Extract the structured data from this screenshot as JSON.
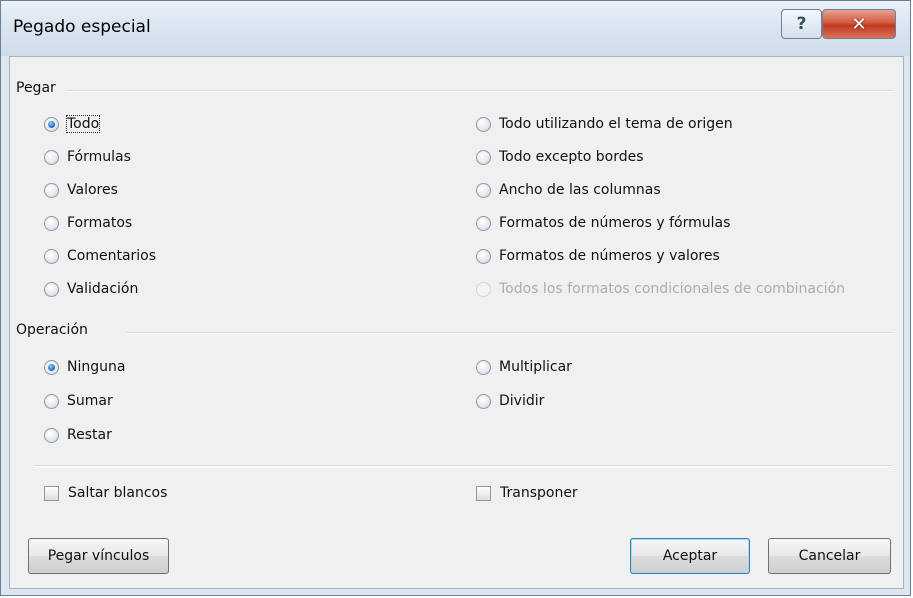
{
  "window": {
    "title": "Pegado especial",
    "help_glyph": "?",
    "close_glyph": "✕"
  },
  "paste": {
    "label": "Pegar",
    "left": [
      {
        "label": "Todo",
        "checked": true
      },
      {
        "label": "Fórmulas",
        "checked": false
      },
      {
        "label": "Valores",
        "checked": false
      },
      {
        "label": "Formatos",
        "checked": false
      },
      {
        "label": "Comentarios",
        "checked": false
      },
      {
        "label": "Validación",
        "checked": false
      }
    ],
    "right": [
      {
        "label": "Todo utilizando el tema de origen",
        "checked": false
      },
      {
        "label": "Todo excepto bordes",
        "checked": false
      },
      {
        "label": "Ancho de las columnas",
        "checked": false
      },
      {
        "label": "Formatos de números y fórmulas",
        "checked": false
      },
      {
        "label": "Formatos de números y valores",
        "checked": false
      },
      {
        "label": "Todos los formatos condicionales de combinación",
        "checked": false,
        "disabled": true
      }
    ]
  },
  "operation": {
    "label": "Operación",
    "left": [
      {
        "label": "Ninguna",
        "checked": true
      },
      {
        "label": "Sumar",
        "checked": false
      },
      {
        "label": "Restar",
        "checked": false
      }
    ],
    "right": [
      {
        "label": "Multiplicar",
        "checked": false
      },
      {
        "label": "Dividir",
        "checked": false
      }
    ]
  },
  "checkboxes": {
    "skip_blanks": {
      "label": "Saltar blancos",
      "checked": false
    },
    "transpose": {
      "label": "Transponer",
      "checked": false
    }
  },
  "buttons": {
    "paste_links": "Pegar vínculos",
    "ok": "Aceptar",
    "cancel": "Cancelar"
  }
}
